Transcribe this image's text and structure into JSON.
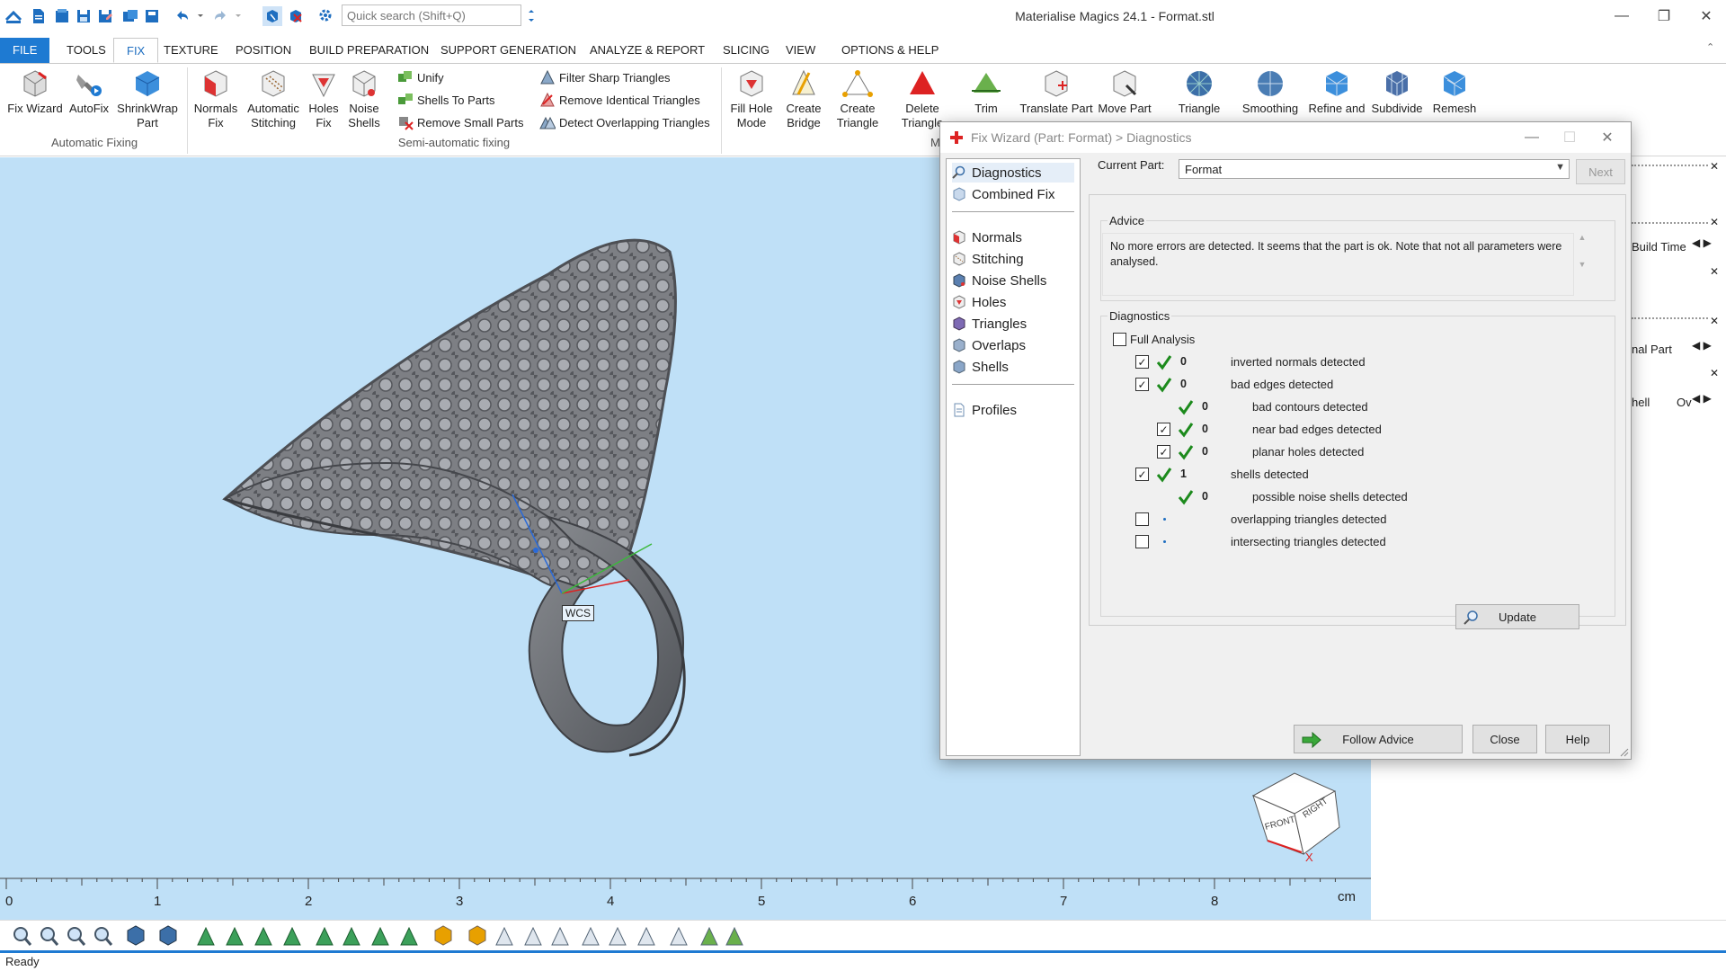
{
  "app": {
    "title": "Materialise Magics 24.1 - Format.stl",
    "search_placeholder": "Quick search (Shift+Q)",
    "window_controls": [
      "minimize-icon",
      "restore-icon",
      "close-icon"
    ]
  },
  "ribbon_tabs": [
    "FILE",
    "TOOLS",
    "FIX",
    "TEXTURE",
    "POSITION",
    "BUILD PREPARATION",
    "SUPPORT GENERATION",
    "ANALYZE & REPORT",
    "SLICING",
    "VIEW",
    "OPTIONS & HELP"
  ],
  "active_tab": "FIX",
  "ribbon": {
    "automatic_fixing": {
      "group_label": "Automatic Fixing",
      "buttons": [
        "Fix Wizard",
        "AutoFix",
        "ShrinkWrap\nPart"
      ]
    },
    "semi_automatic": {
      "group_label": "Semi-automatic fixing",
      "buttons": [
        "Normals\nFix",
        "Automatic\nStitching",
        "Holes\nFix",
        "Noise\nShells"
      ],
      "small_col1": [
        "Unify",
        "Shells To Parts",
        "Remove Small Parts"
      ],
      "small_col2": [
        "Filter Sharp Triangles",
        "Remove Identical Triangles",
        "Detect Overlapping Triangles"
      ]
    },
    "manual": {
      "group_label": "Ma",
      "buttons": [
        "Fill Hole\nMode",
        "Create\nBridge",
        "Create\nTriangle",
        "Delete\nTriangle",
        "Trim",
        "Translate Part",
        "Move Part",
        "Triangle",
        "Smoothing",
        "Refine and",
        "Subdivide",
        "Remesh"
      ]
    }
  },
  "viewport": {
    "background": "#bfe0f7",
    "wcs_label": "WCS",
    "ruler_ticks": [
      "0",
      "1",
      "2",
      "3",
      "4",
      "5",
      "6",
      "7",
      "8"
    ],
    "ruler_unit": "cm",
    "view_cube": {
      "front": "FRONT",
      "right": "RIGHT",
      "x_axis": "X"
    }
  },
  "right_panel": {
    "rows": [
      "Build Time",
      "nal Part",
      "hell",
      "Ov"
    ]
  },
  "status": "Ready",
  "dialog": {
    "title": "Fix Wizard (Part: Format) > Diagnostics",
    "nav": {
      "top": [
        "Diagnostics",
        "Combined Fix"
      ],
      "middle": [
        "Normals",
        "Stitching",
        "Noise Shells",
        "Holes",
        "Triangles",
        "Overlaps",
        "Shells"
      ],
      "bottom": [
        "Profiles"
      ],
      "selected": "Diagnostics"
    },
    "current_part_label": "Current Part:",
    "current_part_value": "Format",
    "next_label": "Next",
    "advice": {
      "legend": "Advice",
      "text": "No more errors are detected. It seems that the part is ok. Note that not all parameters were analysed."
    },
    "diagnostics": {
      "legend": "Diagnostics",
      "full_analysis_label": "Full Analysis",
      "full_analysis_checked": false,
      "rows": [
        {
          "checkbox": true,
          "checked": true,
          "status": "ok",
          "count": "0",
          "text": "inverted normals detected",
          "indent": 0
        },
        {
          "checkbox": true,
          "checked": true,
          "status": "ok",
          "count": "0",
          "text": "bad edges detected",
          "indent": 0
        },
        {
          "checkbox": false,
          "checked": false,
          "status": "ok",
          "count": "0",
          "text": "bad contours detected",
          "indent": 1
        },
        {
          "checkbox": true,
          "checked": true,
          "status": "ok",
          "count": "0",
          "text": "near bad edges detected",
          "indent": 1
        },
        {
          "checkbox": true,
          "checked": true,
          "status": "ok",
          "count": "0",
          "text": "planar holes detected",
          "indent": 1
        },
        {
          "checkbox": true,
          "checked": true,
          "status": "ok",
          "count": "1",
          "text": "shells detected",
          "indent": 0
        },
        {
          "checkbox": false,
          "checked": false,
          "status": "ok",
          "count": "0",
          "text": "possible noise shells detected",
          "indent": 1
        },
        {
          "checkbox": true,
          "checked": false,
          "status": "none",
          "count": "",
          "text": "overlapping triangles detected",
          "indent": 0
        },
        {
          "checkbox": true,
          "checked": false,
          "status": "none",
          "count": "",
          "text": "intersecting triangles detected",
          "indent": 0
        }
      ],
      "update_label": "Update"
    },
    "buttons": {
      "follow_advice": "Follow Advice",
      "close": "Close",
      "help": "Help"
    }
  },
  "colors": {
    "accent": "#1e7ad2",
    "check_green": "#1c8a1c",
    "viewport": "#bfe0f7"
  }
}
